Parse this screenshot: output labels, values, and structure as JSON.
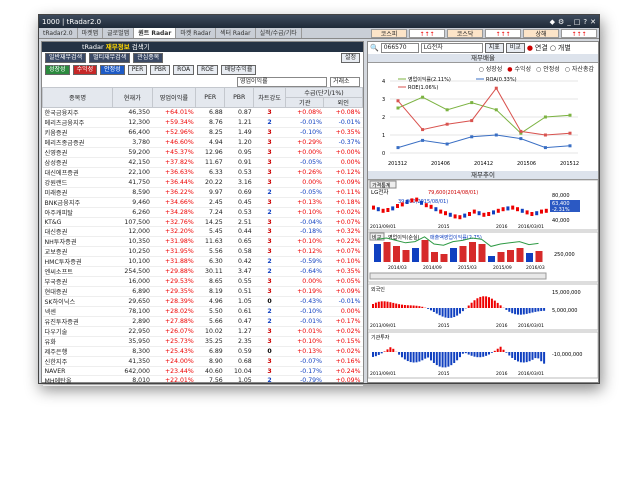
{
  "app": {
    "title": "1000 | tRadar2.0"
  },
  "tabs": [
    "tRadar2.0",
    "마켓맵",
    "글로벌맵",
    "퀀트 Radar",
    "마켓 Radar",
    "섹터 Radar",
    "실적/수급/기타"
  ],
  "top_buttons": [
    "코스피",
    "↑↑↑",
    "코스닥",
    "↑↑↑",
    "상해",
    "↑↑↑"
  ],
  "panel_title": {
    "prefix": "tRadar",
    "bold": "재무정보",
    "suffix": "검색기"
  },
  "left_buttons_row1": [
    "일반재무검색",
    "멀티재무검색",
    "관심종목"
  ],
  "left_btn_extra": "설정",
  "left_buttons_row2": [
    "성장성",
    "수익성",
    "안정성",
    "PER",
    "PBR",
    "ROA",
    "ROE",
    "배당수익률"
  ],
  "sort_select": "영업이익률",
  "sort_order": "거래소",
  "table": {
    "headers": [
      "종목명",
      "현재가",
      "영업이익률",
      "PER",
      "PBR",
      "차트강도",
      "수급(단기/1%)",
      "기관",
      "외인"
    ],
    "rows": [
      [
        "한국금융지주",
        "46,350",
        "+64.01%",
        "6.88",
        "0.87",
        "3",
        "+0.08%",
        "+0.08%"
      ],
      [
        "메리츠금융지주",
        "12,300",
        "+59.34%",
        "8.76",
        "1.21",
        "2",
        "-0.01%",
        "-0.01%"
      ],
      [
        "키움증권",
        "66,400",
        "+52.96%",
        "8.25",
        "1.49",
        "3",
        "-0.10%",
        "+0.35%"
      ],
      [
        "메리츠종금증권",
        "3,780",
        "+46.60%",
        "4.94",
        "1.20",
        "3",
        "+0.29%",
        "-0.37%"
      ],
      [
        "신영증권",
        "59,200",
        "+45.37%",
        "12.96",
        "0.95",
        "3",
        "+0.00%",
        "+0.00%"
      ],
      [
        "삼성증권",
        "42,150",
        "+37.82%",
        "11.67",
        "0.91",
        "3",
        "-0.05%",
        "0.00%"
      ],
      [
        "대신에프증권",
        "22,100",
        "+36.63%",
        "6.33",
        "0.53",
        "3",
        "+0.26%",
        "+0.12%"
      ],
      [
        "강원랜드",
        "41,750",
        "+36.44%",
        "20.22",
        "3.16",
        "3",
        "0.00%",
        "+0.09%"
      ],
      [
        "미래증권",
        "8,590",
        "+36.22%",
        "9.97",
        "0.69",
        "2",
        "-0.05%",
        "+0.11%"
      ],
      [
        "BNK금융지주",
        "9,460",
        "+34.66%",
        "2.45",
        "0.45",
        "3",
        "+0.13%",
        "+0.18%"
      ],
      [
        "아주캐피탈",
        "6,260",
        "+34.28%",
        "7.24",
        "0.53",
        "2",
        "+0.10%",
        "+0.02%"
      ],
      [
        "KT&G",
        "107,500",
        "+32.76%",
        "14.25",
        "2.51",
        "3",
        "-0.04%",
        "+0.07%"
      ],
      [
        "대신증권",
        "12,000",
        "+32.20%",
        "5.45",
        "0.44",
        "3",
        "-0.18%",
        "+0.32%"
      ],
      [
        "NH투자증권",
        "10,350",
        "+31.98%",
        "11.63",
        "0.65",
        "3",
        "+0.10%",
        "+0.22%"
      ],
      [
        "교보증권",
        "10,250",
        "+31.95%",
        "5.56",
        "0.58",
        "3",
        "+0.12%",
        "+0.07%"
      ],
      [
        "HMC투자증권",
        "10,100",
        "+31.88%",
        "6.30",
        "0.42",
        "2",
        "-0.59%",
        "+0.10%"
      ],
      [
        "엔씨소프트",
        "254,500",
        "+29.88%",
        "30.11",
        "3.47",
        "2",
        "-0.64%",
        "+0.35%"
      ],
      [
        "부국증권",
        "16,000",
        "+29.53%",
        "8.65",
        "0.55",
        "3",
        "0.00%",
        "+0.05%"
      ],
      [
        "현대증권",
        "6,890",
        "+29.35%",
        "8.19",
        "0.51",
        "3",
        "+0.19%",
        "+0.09%"
      ],
      [
        "SK하이닉스",
        "29,650",
        "+28.39%",
        "4.96",
        "1.05",
        "0",
        "-0.43%",
        "-0.01%"
      ],
      [
        "넥센",
        "78,100",
        "+28.02%",
        "5.50",
        "0.61",
        "2",
        "-0.10%",
        "0.00%"
      ],
      [
        "유진투자증권",
        "2,890",
        "+27.88%",
        "5.66",
        "0.47",
        "2",
        "-0.01%",
        "+0.17%"
      ],
      [
        "다우기술",
        "22,950",
        "+26.07%",
        "10.02",
        "1.27",
        "3",
        "+0.01%",
        "+0.02%"
      ],
      [
        "유화",
        "35,950",
        "+25.73%",
        "35.25",
        "2.35",
        "3",
        "+0.10%",
        "+0.15%"
      ],
      [
        "제주은행",
        "8,300",
        "+25.43%",
        "6.89",
        "0.59",
        "0",
        "+0.13%",
        "+0.02%"
      ],
      [
        "신한지주",
        "41,350",
        "+24.00%",
        "8.90",
        "0.68",
        "3",
        "-0.07%",
        "+0.16%"
      ],
      [
        "NAVER",
        "642,000",
        "+23.44%",
        "40.60",
        "10.04",
        "3",
        "-0.17%",
        "+0.24%"
      ],
      [
        "MH에탄올",
        "8,010",
        "+22.01%",
        "7.56",
        "1.05",
        "2",
        "-0.79%",
        "+0.09%"
      ]
    ]
  },
  "right": {
    "code": "066570",
    "name": "LG전자",
    "btn1": "지표",
    "btn2": "비교",
    "radio1": "연결",
    "radio2": "개별",
    "section1": "재무배율",
    "metric_radios": [
      "성장성",
      "수익성",
      "안정성",
      "자산총감"
    ],
    "chart1": {
      "type": "line",
      "x": [
        "201312",
        "201406",
        "201412",
        "201506",
        "201512"
      ],
      "series": [
        {
          "name": "영업이익률(2.11%)",
          "color": "#7cb342",
          "values": [
            2.5,
            3.1,
            2.4,
            2.8,
            2.4,
            1.1,
            2.0,
            2.1
          ]
        },
        {
          "name": "ROA(0.33%)",
          "color": "#3a6fc4",
          "values": [
            0.3,
            0.7,
            0.5,
            0.9,
            1.0,
            0.8,
            0.3,
            0.4
          ]
        },
        {
          "name": "ROE(1.06%)",
          "color": "#d9534f",
          "values": [
            2.9,
            1.3,
            1.6,
            1.8,
            3.6,
            1.2,
            1.0,
            1.1
          ]
        }
      ],
      "ylim": [
        0,
        4
      ]
    },
    "section2": "재무추이",
    "btn_price": "가격통계",
    "chart2": {
      "label": "LG전자",
      "ann_high": "79,600(2014/08/01)",
      "ann_low": "39,300(2015/08/01)",
      "yticks": [
        "80,000",
        "63,400",
        "40,000"
      ],
      "change": "-2.31%",
      "dates": [
        "2013/09/01",
        "2015",
        "2016",
        "2016/03/01"
      ]
    },
    "chart3": {
      "label": "영업이익(순실)",
      "label2": "매출액영업이익률(2.75)",
      "ytick": "250,000",
      "dates": [
        "2014/03",
        "2014/09",
        "2015/03",
        "2015/09",
        "2016/03"
      ],
      "btn": "비교"
    },
    "chart4": {
      "label": "외국인",
      "yticks": [
        "15,000,000",
        "5,000,000"
      ],
      "dates": [
        "2013/09/01",
        "2015",
        "2016",
        "2016/03/01"
      ]
    },
    "chart5": {
      "label": "기관투자",
      "ytick": "-10,000,000",
      "dates": [
        "2013/09/01",
        "2015",
        "2016",
        "2016/03/01"
      ]
    }
  }
}
